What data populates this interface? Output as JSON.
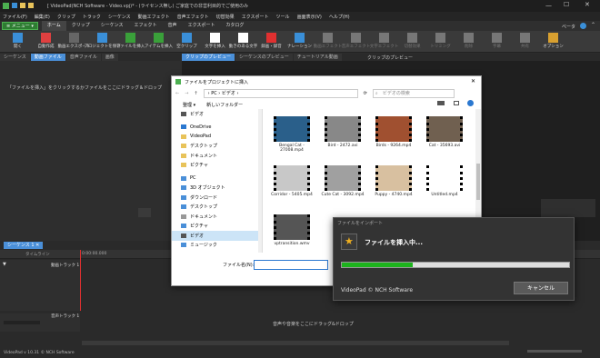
{
  "app": {
    "title": "[ VideoPad(NCH Software - Video.vpj)* - (ライセンス無し) ご家庭での非営利目的でご使用のみ",
    "status": "VideoPad v 10.31 © NCH Software"
  },
  "menubar": [
    "ファイル(F)",
    "編集(E)",
    "クリップ",
    "トラック",
    "シーケンス",
    "動画エフェクト",
    "音声エフェクト",
    "切替効果",
    "エクスポート",
    "ツール",
    "画面表示(V)",
    "ヘルプ(H)"
  ],
  "menu_button": "≡ メニュー ▾",
  "ribbon_tabs": [
    "ホーム",
    "クリップ",
    "シーケンス",
    "エフェクト",
    "音声",
    "エクスポート",
    "カタログ"
  ],
  "beta_label": "ベータ",
  "toolbar": [
    {
      "label": "開く",
      "icon": "open-icon",
      "color": "#3a8fd8"
    },
    {
      "label": "自動作成",
      "icon": "auto-create-icon",
      "color": "#e04040"
    },
    {
      "label": "動画エクスポート",
      "icon": "export-video-icon",
      "color": "#666"
    },
    {
      "label": "プロジェクトを保存",
      "icon": "save-project-icon",
      "color": "#3a8fd8"
    },
    {
      "label": "ファイルを挿入",
      "icon": "insert-file-icon",
      "color": "#3aa03a"
    },
    {
      "label": "アイテムを挿入",
      "icon": "insert-item-icon",
      "color": "#3aa03a"
    },
    {
      "label": "空クリップ",
      "icon": "blank-clip-icon",
      "color": "#3a8fd8"
    },
    {
      "label": "文字を挿入",
      "icon": "insert-text-icon",
      "color": "#fff"
    },
    {
      "label": "動きのある文字",
      "icon": "animated-text-icon",
      "color": "#fff"
    },
    {
      "label": "録画・録音",
      "icon": "record-icon",
      "color": "#e03030"
    },
    {
      "label": "ナレーション",
      "icon": "narration-icon",
      "color": "#3a8fd8"
    },
    {
      "label": "動画エフェクト",
      "icon": "video-effects-icon",
      "color": "#777"
    },
    {
      "label": "音声エフェクト",
      "icon": "audio-effects-icon",
      "color": "#777"
    },
    {
      "label": "文字エフェクト",
      "icon": "text-effects-icon",
      "color": "#777"
    },
    {
      "label": "切替効果",
      "icon": "transition-icon",
      "color": "#777"
    },
    {
      "label": "トリミング",
      "icon": "trim-icon",
      "color": "#777"
    },
    {
      "label": "削除",
      "icon": "delete-icon",
      "color": "#777"
    },
    {
      "label": "字幕",
      "icon": "subtitle-icon",
      "color": "#777"
    },
    {
      "label": "共有",
      "icon": "share-icon",
      "color": "#777"
    },
    {
      "label": "オプション",
      "icon": "options-icon",
      "color": "#d8a030"
    }
  ],
  "left_tabs": [
    "シーケンス",
    "動画ファイル",
    "音声ファイル",
    "画像"
  ],
  "left_hint": "「ファイルを挿入」をクリックするかファイルをここにドラッグ＆ドロップ",
  "right_tabs": [
    "クリップのプレビュー",
    "シーケンスのプレビュー",
    "チュートリアル動画"
  ],
  "right_title": "クリップのプレビュー",
  "timeline": {
    "tab": "シーケンス 1",
    "time": "0:00:00.000",
    "timescale": "タイムライン",
    "video_track": "動画トラック 1",
    "audio_track": "音声トラック 1",
    "audio_hint": "音声や音楽をここにドラッグ&ドロップ"
  },
  "dialog": {
    "title": "ファイルをプロジェクトに挿入",
    "breadcrumb": "› PC › ビデオ ›",
    "search_placeholder": "ビデオの検索",
    "organize": "整理 ▾",
    "new_folder": "新しいフォルダー",
    "filename_label": "ファイル名(N):",
    "nav": [
      {
        "label": "ビデオ",
        "color": "#555"
      },
      {
        "label": "",
        "color": ""
      },
      {
        "label": "OneDrive",
        "color": "#2b78d0"
      },
      {
        "label": "VideoPad",
        "color": "#e8c35a"
      },
      {
        "label": "デスクトップ",
        "color": "#e8c35a"
      },
      {
        "label": "ドキュメント",
        "color": "#e8c35a"
      },
      {
        "label": "ピクチャ",
        "color": "#e8c35a"
      },
      {
        "label": "",
        "color": ""
      },
      {
        "label": "PC",
        "color": "#4a8fd8"
      },
      {
        "label": "3D オブジェクト",
        "color": "#4a8fd8"
      },
      {
        "label": "ダウンロード",
        "color": "#4a8fd8"
      },
      {
        "label": "デスクトップ",
        "color": "#4a8fd8"
      },
      {
        "label": "ドキュメント",
        "color": "#999"
      },
      {
        "label": "ピクチャ",
        "color": "#4a8fd8"
      },
      {
        "label": "ビデオ",
        "color": "#555"
      },
      {
        "label": "ミュージック",
        "color": "#4a8fd8"
      }
    ],
    "files": [
      {
        "name": "Bengal Cat - 27008.mp4",
        "bg": "#2a5f8a"
      },
      {
        "name": "Bird - 2472.avi",
        "bg": "#888"
      },
      {
        "name": "Birds - 9264.mp4",
        "bg": "#a05030"
      },
      {
        "name": "Cat - 35693.avi",
        "bg": "#706050"
      },
      {
        "name": "Corridor - 5405.mp4",
        "bg": "#c8c8c8"
      },
      {
        "name": "Cute Cat - 3092.mp4",
        "bg": "#a0a0a0"
      },
      {
        "name": "Puppy - 4740.mp4",
        "bg": "#d8c0a0"
      },
      {
        "name": "Untitled.mp4",
        "bg": "#ffffff"
      },
      {
        "name": "vptransition.wmv",
        "bg": "#555"
      }
    ]
  },
  "import": {
    "caption": "ファイルをインポート",
    "message": "ファイルを挿入中...",
    "progress": 0.31,
    "footer": "VideoPad © NCH Software",
    "cancel": "キャンセル"
  },
  "colors": {
    "accent": "#4a8fd8",
    "green": "#2e7d32",
    "progress": "#1db31d"
  }
}
